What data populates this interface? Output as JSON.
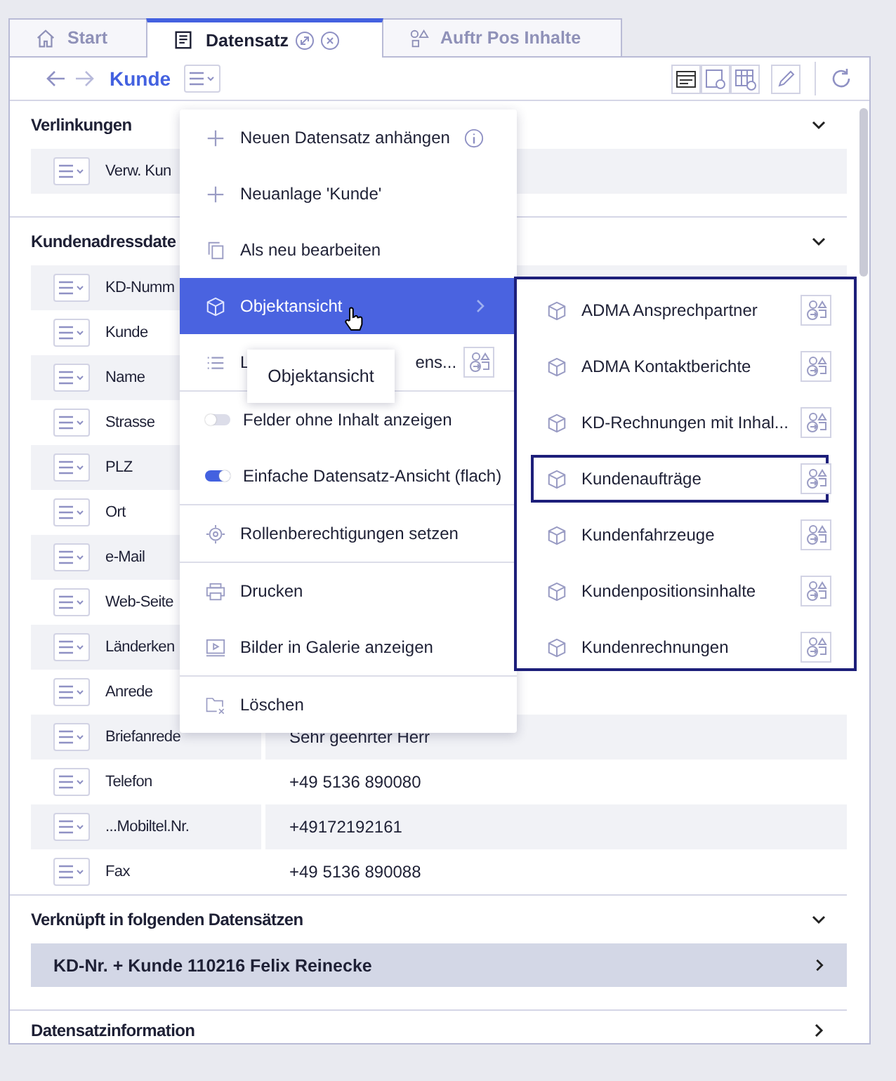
{
  "tabs": [
    {
      "label": "Start",
      "kind": "home",
      "selected": false
    },
    {
      "label": "Datensatz",
      "kind": "record",
      "selected": true
    },
    {
      "label": "Auftr Pos Inhalte",
      "kind": "shapes",
      "selected": false
    }
  ],
  "toolbar": {
    "title": "Kunde"
  },
  "sections": [
    {
      "title": "Verlinkungen",
      "expanded": true,
      "rows": [
        {
          "label": "Verw. Kun"
        }
      ]
    },
    {
      "title": "Kundenadressdate",
      "expanded": true,
      "rows": [
        {
          "label": "KD-Numm"
        },
        {
          "label": "Kunde"
        },
        {
          "label": "Name"
        },
        {
          "label": "Strasse"
        },
        {
          "label": "PLZ"
        },
        {
          "label": "Ort"
        },
        {
          "label": "e-Mail"
        },
        {
          "label": "Web-Seite"
        },
        {
          "label": "Länderken"
        },
        {
          "label": "Anrede"
        },
        {
          "label": "Briefanrede",
          "value": "Sehr geehrter Herr"
        },
        {
          "label": "Telefon",
          "value": "+49 5136 890080"
        },
        {
          "label": "...Mobiltel.Nr.",
          "value": "+49172192161"
        },
        {
          "label": "Fax",
          "value": "+49 5136 890088"
        }
      ]
    },
    {
      "title": "Verknüpft in folgenden Datensätzen",
      "expanded": true,
      "links": [
        {
          "label": "KD-Nr. + Kunde 110216 Felix Reinecke"
        }
      ]
    },
    {
      "title": "Datensatzinformation",
      "expanded": false
    }
  ],
  "menu": {
    "groups": [
      [
        {
          "kind": "add",
          "label": "Neuen Datensatz anhängen",
          "info": true,
          "selected": false
        },
        {
          "kind": "add",
          "label": "Neuanlage 'Kunde'",
          "info": false,
          "selected": false
        },
        {
          "kind": "copy",
          "label": "Als neu bearbeiten",
          "info": false,
          "selected": false
        },
        {
          "kind": "object",
          "label": "Objektansicht",
          "submenu": true,
          "selected": true
        },
        {
          "kind": "list",
          "label_parts": [
            "L",
            "ens..."
          ],
          "selected": false
        }
      ],
      [
        {
          "kind": "toggle",
          "label": "Felder ohne Inhalt anzeigen",
          "on": false
        },
        {
          "kind": "toggle",
          "label": "Einfache Datensatz-Ansicht (flach)",
          "on": true
        }
      ],
      [
        {
          "kind": "roles",
          "label": "Rollenberechtigungen setzen",
          "selected": false
        }
      ],
      [
        {
          "kind": "print",
          "label": "Drucken",
          "selected": false
        },
        {
          "kind": "gallery",
          "label": "Bilder in Galerie anzeigen",
          "selected": false
        }
      ],
      [
        {
          "kind": "delete",
          "label": "Löschen",
          "selected": false
        }
      ]
    ]
  },
  "submenu": {
    "items": [
      {
        "label": "ADMA Ansprechpartner",
        "selected": false
      },
      {
        "label": "ADMA Kontaktberichte",
        "selected": false
      },
      {
        "label": "KD-Rechnungen mit Inhal...",
        "selected": false
      },
      {
        "label": "Kundenaufträge",
        "selected": true
      },
      {
        "label": "Kundenfahrzeuge",
        "selected": false
      },
      {
        "label": "Kundenpositionsinhalte",
        "selected": false
      },
      {
        "label": "Kundenrechnungen",
        "selected": false
      }
    ]
  },
  "tooltip": {
    "text": "Objektansicht"
  }
}
